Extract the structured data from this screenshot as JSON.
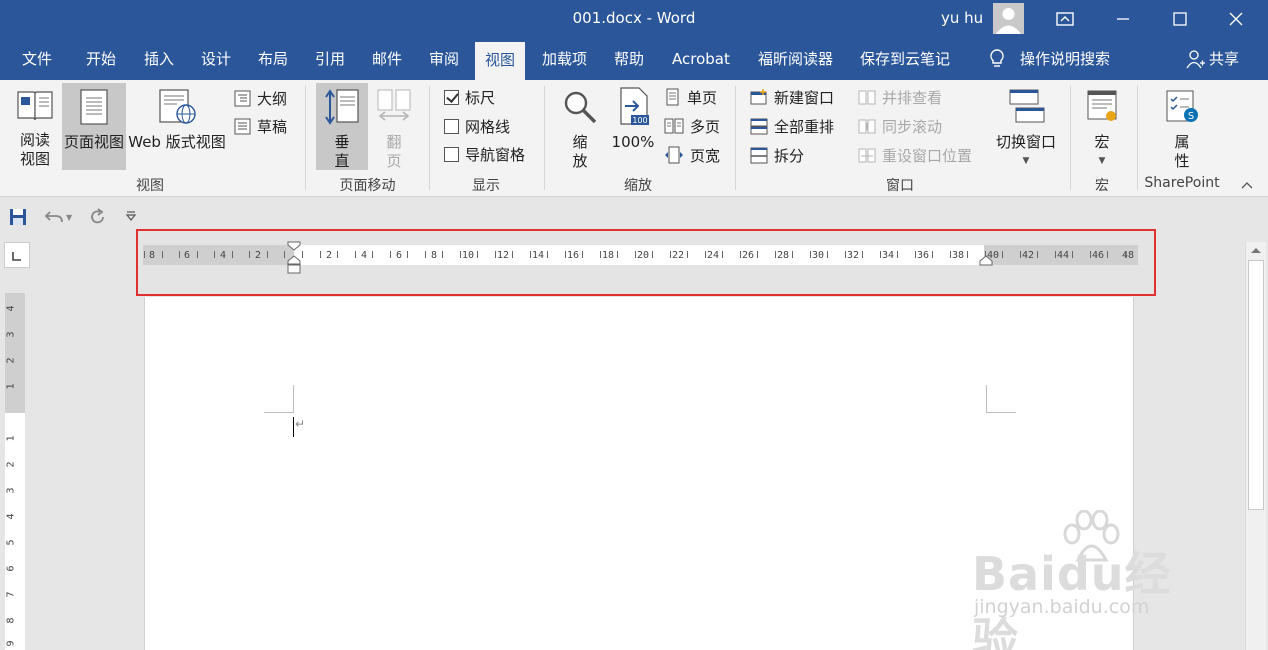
{
  "window": {
    "title": "001.docx  -  Word",
    "user_name": "yu hu"
  },
  "tabs": [
    "文件",
    "开始",
    "插入",
    "设计",
    "布局",
    "引用",
    "邮件",
    "审阅",
    "视图",
    "加载项",
    "帮助",
    "Acrobat",
    "福昕阅读器",
    "保存到云笔记"
  ],
  "active_tab": "视图",
  "tell_me": "操作说明搜索",
  "share": "共享",
  "ribbon": {
    "view_group": {
      "label": "视图",
      "read_mode": "阅读\n视图",
      "print_layout": "页面视图",
      "web_layout": "Web 版式视图",
      "outline": "大纲",
      "draft": "草稿"
    },
    "page_move_group": {
      "label": "页面移动",
      "vertical": "垂\n直",
      "side_to_side": "翻\n页"
    },
    "show_group": {
      "label": "显示",
      "ruler": "标尺",
      "ruler_checked": true,
      "gridlines": "网格线",
      "gridlines_checked": false,
      "nav_pane": "导航窗格",
      "nav_pane_checked": false
    },
    "zoom_group": {
      "label": "缩放",
      "zoom": "缩\n放",
      "hundred": "100%",
      "one_page": "单页",
      "multiple_pages": "多页",
      "page_width": "页宽"
    },
    "window_group": {
      "label": "窗口",
      "new_window": "新建窗口",
      "arrange_all": "全部重排",
      "split": "拆分",
      "side_by_side": "并排查看",
      "sync_scroll": "同步滚动",
      "reset_position": "重设窗口位置",
      "switch_windows": "切换窗口"
    },
    "macros_group": {
      "label": "宏",
      "macros": "宏"
    },
    "sharepoint_group": {
      "label": "SharePoint",
      "properties": "属\n性"
    }
  },
  "ruler": {
    "left_labels": [
      "8",
      "6",
      "4",
      "2"
    ],
    "right_labels": [
      "2",
      "4",
      "6",
      "8",
      "10",
      "12",
      "14",
      "16",
      "18",
      "20",
      "22",
      "24",
      "26",
      "28",
      "30",
      "32",
      "34",
      "36",
      "38",
      "40",
      "42",
      "44",
      "46",
      "48"
    ]
  },
  "vertical_ruler": {
    "top_labels": [
      "4",
      "3",
      "2",
      "1"
    ],
    "bottom_labels": [
      "1",
      "2",
      "3",
      "4",
      "5",
      "6",
      "7",
      "8",
      "9"
    ]
  },
  "watermark": {
    "big": "Baidu经验",
    "small": "jingyan.baidu.com"
  }
}
